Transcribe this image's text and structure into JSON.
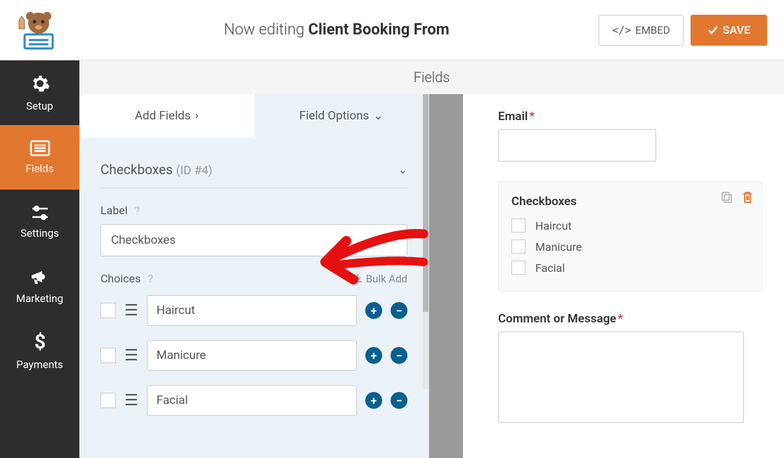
{
  "header": {
    "editing_prefix": "Now editing ",
    "editing_title": "Client Booking From",
    "embed_button": "EMBED",
    "save_button": "SAVE"
  },
  "sidebar": {
    "items": [
      {
        "label": "Setup",
        "icon": "gear"
      },
      {
        "label": "Fields",
        "icon": "list"
      },
      {
        "label": "Settings",
        "icon": "sliders"
      },
      {
        "label": "Marketing",
        "icon": "megaphone"
      },
      {
        "label": "Payments",
        "icon": "dollar"
      }
    ]
  },
  "fields_header": "Fields",
  "tabs": {
    "add_fields": "Add Fields",
    "field_options": "Field Options"
  },
  "field_options": {
    "title": "Checkboxes",
    "id_suffix": "(ID #4)",
    "label_heading": "Label",
    "label_value": "Checkboxes",
    "choices_heading": "Choices",
    "bulk_add": "Bulk Add",
    "choices": [
      {
        "value": "Haircut"
      },
      {
        "value": "Manicure"
      },
      {
        "value": "Facial"
      }
    ]
  },
  "preview": {
    "email_label": "Email",
    "checkboxes_label": "Checkboxes",
    "checkbox_items": [
      "Haircut",
      "Manicure",
      "Facial"
    ],
    "comment_label": "Comment or Message"
  }
}
